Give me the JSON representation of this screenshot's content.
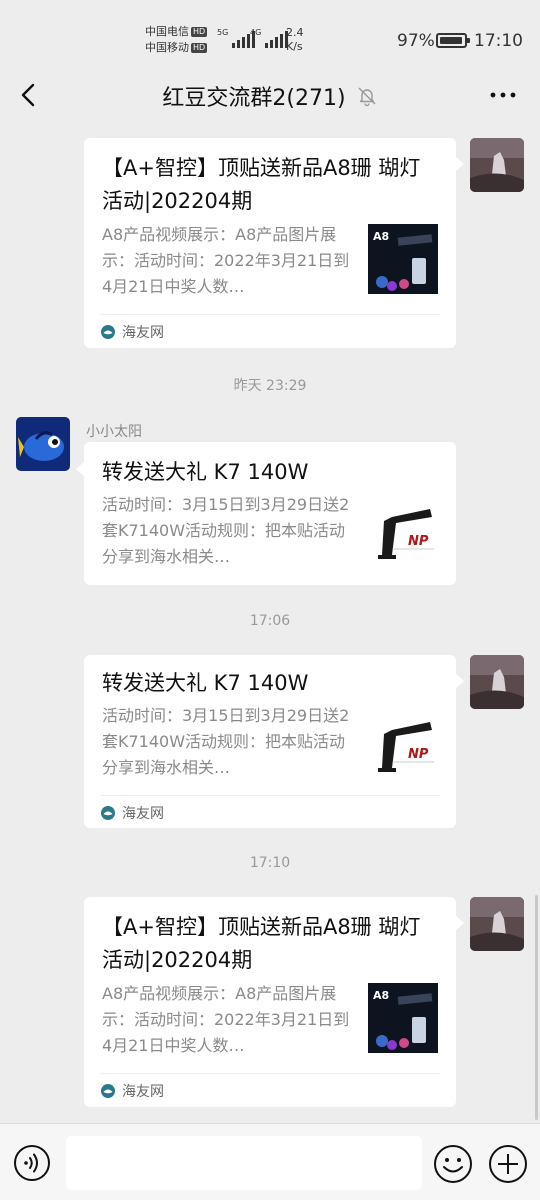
{
  "status_bar": {
    "carrier1": "中国电信",
    "carrier2": "中国移动",
    "hd": "HD",
    "signal1_label": "5G",
    "signal2_label": "4G",
    "speed_value": "2.4",
    "speed_unit": "K/s",
    "battery_percent": "97%",
    "battery_level": 0.97,
    "time": "17:10"
  },
  "header": {
    "title": "红豆交流群2(271)",
    "muted_icon": "bell-off-icon",
    "back_icon": "chevron-left-icon",
    "more_icon": "more-dots-icon"
  },
  "messages": [
    {
      "title": "【A+智控】顶贴送新品A8珊 瑚灯活动|202204期",
      "desc": "A8产品视频展示：A8产品图片展示：活动时间：2022年3月21日到4月21日中奖人数…",
      "thumb_text": "A8",
      "source": "海友网"
    },
    {
      "timestamp": "昨天 23:29",
      "sender": "小小太阳",
      "title": "转发送大礼  K7 140W",
      "desc": "活动时间：3月15日到3月29日送2套K7140W活动规则：把本贴活动分享到海水相关…",
      "thumb_text": "NP"
    },
    {
      "timestamp": "17:06",
      "title": "转发送大礼  K7 140W",
      "desc": "活动时间：3月15日到3月29日送2套K7140W活动规则：把本贴活动分享到海水相关…",
      "thumb_text": "NP",
      "source": "海友网"
    },
    {
      "timestamp": "17:10",
      "title": "【A+智控】顶贴送新品A8珊 瑚灯活动|202204期",
      "desc": "A8产品视频展示：A8产品图片展示：活动时间：2022年3月21日到4月21日中奖人数…",
      "thumb_text": "A8",
      "source": "海友网"
    }
  ],
  "input": {
    "value": ""
  },
  "colors": {
    "background": "#ededed",
    "card": "#ffffff",
    "source_icon": "#2a7a8c"
  }
}
